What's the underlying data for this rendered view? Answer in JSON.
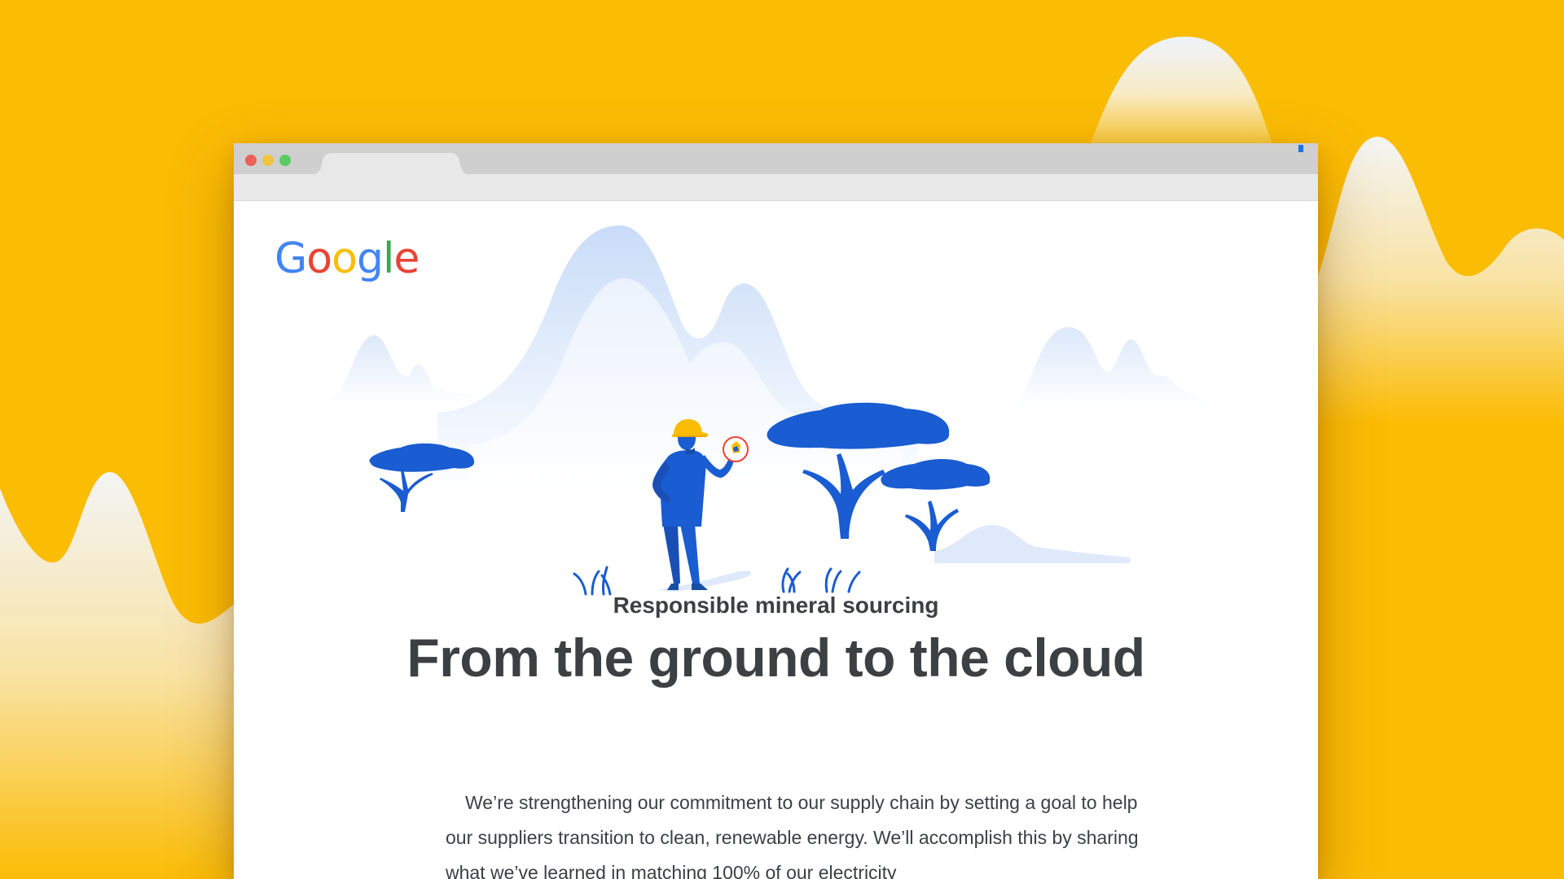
{
  "browser": {
    "buttons": [
      {
        "name": "close",
        "color": "#EE5F57"
      },
      {
        "name": "minimize",
        "color": "#F0C43E"
      },
      {
        "name": "maximize",
        "color": "#5BCB63"
      }
    ],
    "active_tab_label": ""
  },
  "page": {
    "logo": {
      "letters": [
        {
          "char": "G",
          "color": "#4285F4"
        },
        {
          "char": "o",
          "color": "#EA4335"
        },
        {
          "char": "o",
          "color": "#FBBC05"
        },
        {
          "char": "g",
          "color": "#4285F4"
        },
        {
          "char": "l",
          "color": "#34A853"
        },
        {
          "char": "e",
          "color": "#EA4335"
        }
      ]
    },
    "eyebrow": "Responsible mineral sourcing",
    "headline": "From the ground to the cloud",
    "body_text": "We’re strengthening our commitment to our supply chain by setting a goal to help our suppliers transition to clean, renewable energy. We’ll accomplish this by sharing what we’ve learned in matching 100% of our electricity"
  },
  "colors": {
    "background": "#FBBC04",
    "illustration_blue": "#1A5CD1",
    "mountain_blue": "#C9DCF8",
    "text": "#3C4043",
    "helmet": "#FBBC04"
  },
  "icons": [
    "google-logo",
    "worker-figure",
    "acacia-tree",
    "mineral-stone-icon"
  ]
}
